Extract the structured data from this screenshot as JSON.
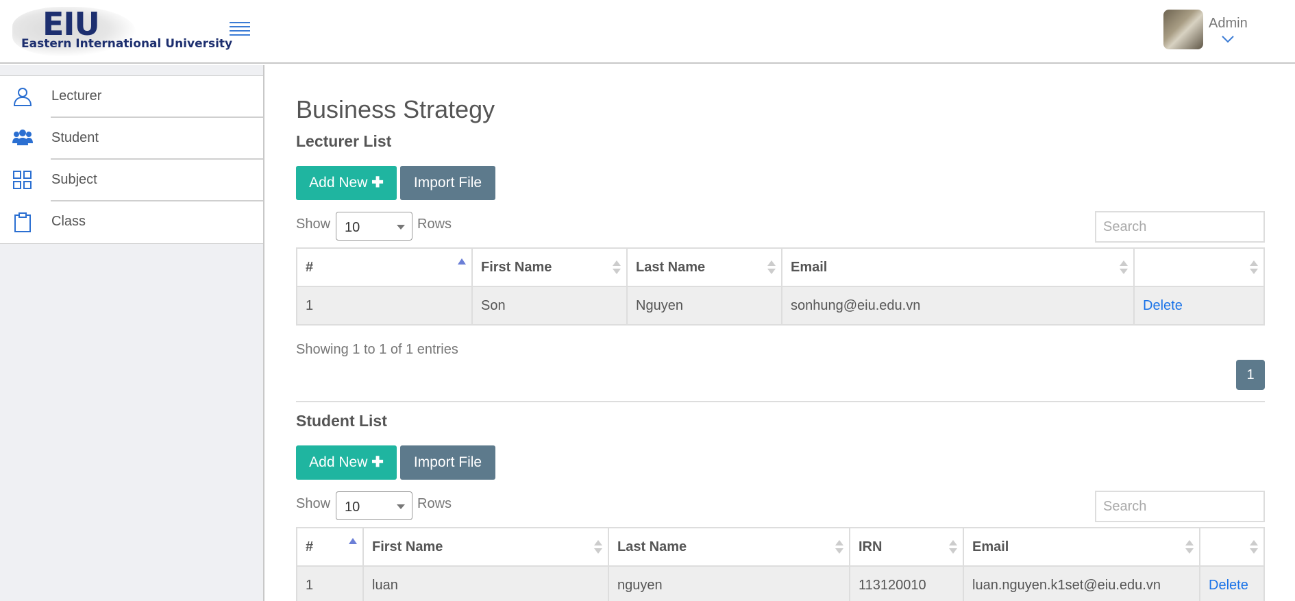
{
  "header": {
    "logo_text": "EIU",
    "logo_subtitle": "Eastern International University",
    "user_name": "Admin"
  },
  "sidebar": {
    "items": [
      {
        "label": "Lecturer",
        "icon": "user-outline-icon"
      },
      {
        "label": "Student",
        "icon": "users-group-icon"
      },
      {
        "label": "Subject",
        "icon": "grid-icon"
      },
      {
        "label": "Class",
        "icon": "clipboard-icon"
      }
    ]
  },
  "main": {
    "title": "Business Strategy",
    "lecturer": {
      "title": "Lecturer List",
      "add_label": "Add New",
      "import_label": "Import File",
      "show_label": "Show",
      "rows_label": "Rows",
      "rows_value": "10",
      "search_placeholder": "Search",
      "columns": [
        "#",
        "First Name",
        "Last Name",
        "Email",
        ""
      ],
      "rows": [
        [
          "1",
          "Son",
          "Nguyen",
          "sonhung@eiu.edu.vn",
          "Delete"
        ]
      ],
      "info": "Showing 1 to 1 of 1 entries",
      "page": "1"
    },
    "student": {
      "title": "Student List",
      "add_label": "Add New",
      "import_label": "Import File",
      "show_label": "Show",
      "rows_label": "Rows",
      "rows_value": "10",
      "search_placeholder": "Search",
      "columns": [
        "#",
        "First Name",
        "Last Name",
        "IRN",
        "Email",
        ""
      ],
      "rows": [
        [
          "1",
          "luan",
          "nguyen",
          "113120010",
          "luan.nguyen.k1set@eiu.edu.vn",
          "Delete"
        ]
      ]
    }
  },
  "colors": {
    "accent_teal": "#1fb5a0",
    "slate_button": "#5d7a8c",
    "link_blue": "#1a73e8",
    "logo_navy": "#1d2f6f"
  }
}
